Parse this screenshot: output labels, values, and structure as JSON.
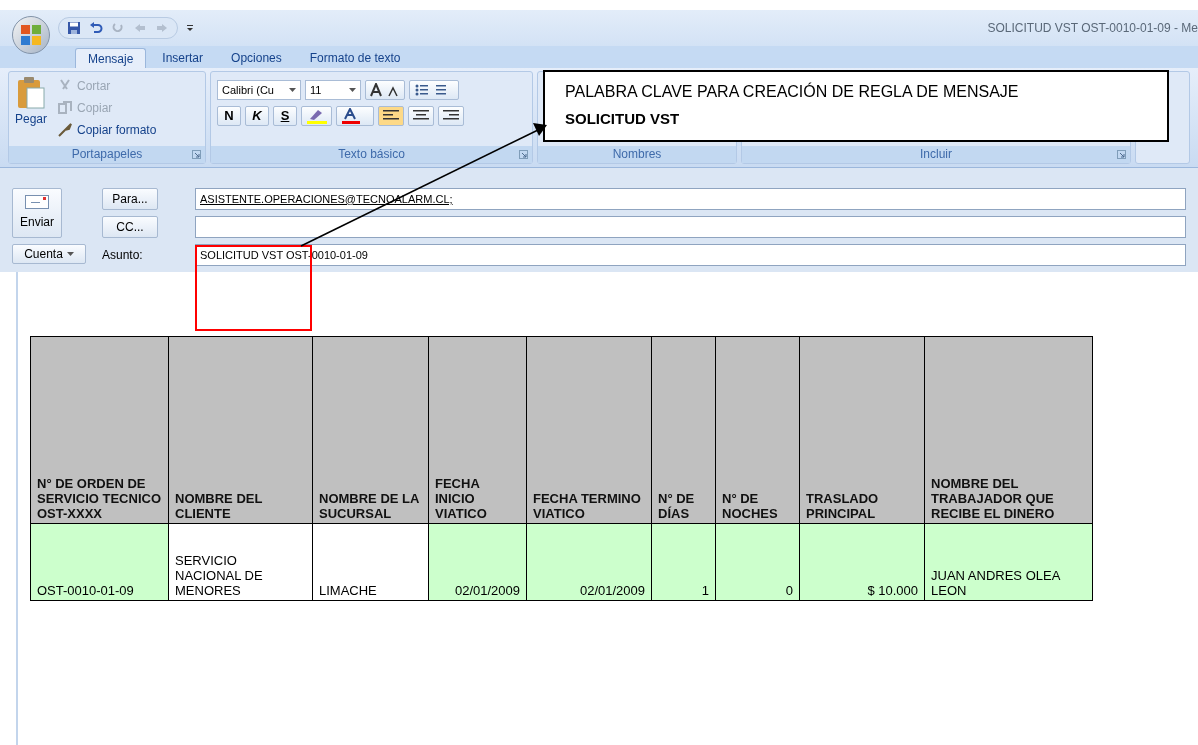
{
  "window": {
    "title": "SOLICITUD VST OST-0010-01-09 - Me"
  },
  "tabs": [
    {
      "label": "Mensaje",
      "selected": true
    },
    {
      "label": "Insertar",
      "selected": false
    },
    {
      "label": "Opciones",
      "selected": false
    },
    {
      "label": "Formato de texto",
      "selected": false
    }
  ],
  "clipboard": {
    "paste": "Pegar",
    "items": [
      {
        "label": "Cortar",
        "disabled": true
      },
      {
        "label": "Copiar",
        "disabled": true
      },
      {
        "label": "Copiar formato",
        "disabled": false
      }
    ],
    "group": "Portapapeles"
  },
  "basic_text": {
    "font": "Calibri (Cu",
    "size": "11",
    "bold": "N",
    "italic": "K",
    "underline": "S",
    "group": "Texto básico"
  },
  "groups": [
    "Nombres",
    "Incluir"
  ],
  "compose": {
    "send": "Enviar",
    "to_button": "Para...",
    "to": "ASISTENTE.OPERACIONES@TECNOALARM.CL;",
    "cc_button": "CC...",
    "account": "Cuenta",
    "subject_label": "Asunto:",
    "subject": "SOLICITUD VST OST-0010-01-09"
  },
  "table": {
    "columns": [
      "N° DE ORDEN DE SERVICIO TECNICO OST-XXXX",
      "NOMBRE DEL CLIENTE",
      "NOMBRE DE LA SUCURSAL",
      "FECHA INICIO VIATICO",
      "FECHA TERMINO VIATICO",
      "N° DE DÍAS",
      "N° DE NOCHES",
      "TRASLADO PRINCIPAL",
      "NOMBRE DEL TRABAJADOR QUE RECIBE EL DINERO"
    ],
    "rows": [
      [
        {
          "text": "OST-0010-01-09",
          "shaded": true,
          "kind": "text"
        },
        {
          "text": "SERVICIO NACIONAL DE MENORES",
          "shaded": false,
          "kind": "text"
        },
        {
          "text": "LIMACHE",
          "shaded": false,
          "kind": "text"
        },
        {
          "text": "02/01/2009",
          "shaded": true,
          "kind": "number"
        },
        {
          "text": "02/01/2009",
          "shaded": true,
          "kind": "number"
        },
        {
          "text": "1",
          "shaded": true,
          "kind": "number"
        },
        {
          "text": "0",
          "shaded": true,
          "kind": "number"
        },
        {
          "text": "$ 10.000",
          "shaded": true,
          "kind": "number"
        },
        {
          "text": "JUAN ANDRES OLEA LEON",
          "shaded": true,
          "kind": "text"
        }
      ]
    ]
  },
  "callout": {
    "text": "PALABRA CLAVE PARA CREACIÓN DE REGLA DE MENSAJE",
    "keyword": "SOLICITUD VST"
  }
}
